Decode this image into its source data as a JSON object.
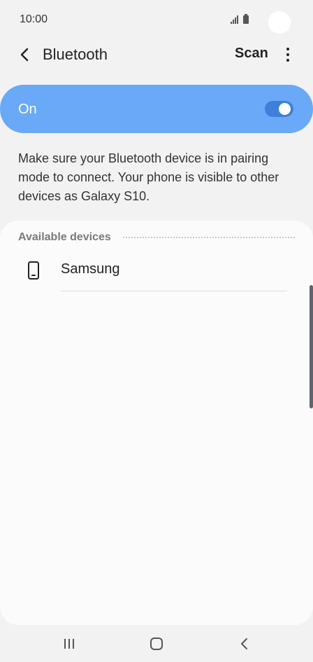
{
  "status_bar": {
    "time": "10:00",
    "icons": [
      "signal-icon",
      "battery-icon"
    ]
  },
  "app_bar": {
    "title": "Bluetooth",
    "scan_label": "Scan",
    "back_icon": "chevron-left-icon",
    "more_icon": "more-vert-icon"
  },
  "toggle": {
    "label": "On",
    "state": true,
    "accent_color": "#6aa9f7"
  },
  "description": "Make sure your Bluetooth device is in pairing mode to connect. Your phone is visible to other devices as Galaxy S10.",
  "available_devices": {
    "header": "Available devices",
    "items": [
      {
        "name": "Samsung",
        "icon": "phone-icon"
      }
    ]
  },
  "nav_bar": {
    "items": [
      "recents-icon",
      "home-icon",
      "back-icon"
    ]
  }
}
